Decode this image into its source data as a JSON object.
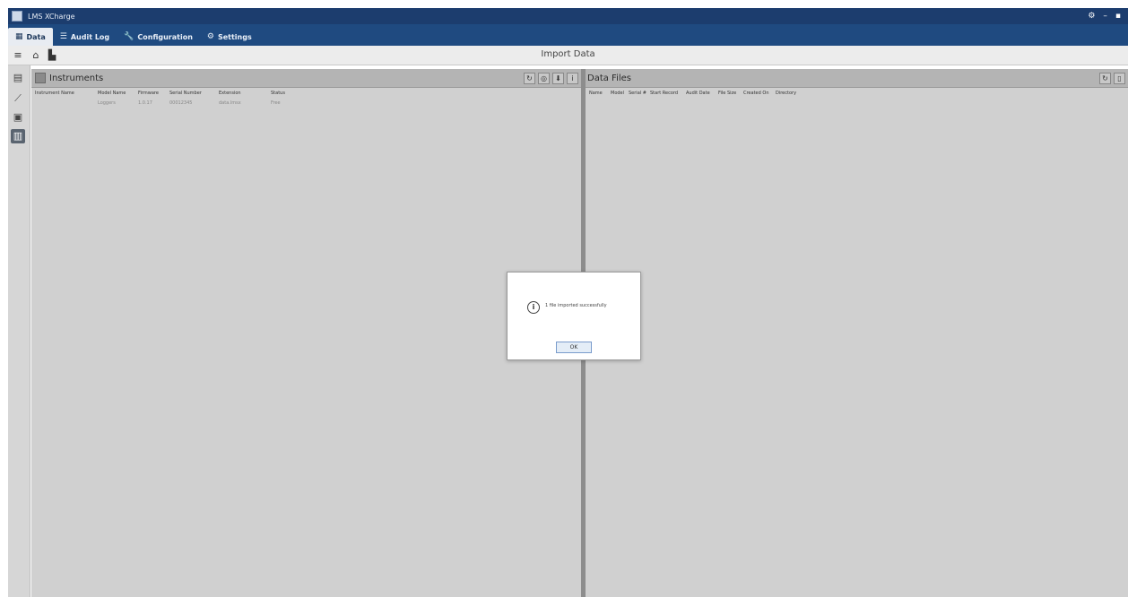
{
  "window": {
    "title": "LMS XCharge",
    "controls": [
      "⚙",
      "–",
      "▪"
    ]
  },
  "menu": [
    {
      "label": "Data",
      "icon": "▦",
      "active": true
    },
    {
      "label": "Audit Log",
      "icon": "☰",
      "active": false
    },
    {
      "label": "Configuration",
      "icon": "🔧",
      "active": false
    },
    {
      "label": "Settings",
      "icon": "⚙",
      "active": false
    }
  ],
  "toolbar": {
    "page_title": "Import Data"
  },
  "instruments": {
    "title": "Instruments",
    "columns": [
      "Instrument Name",
      "Model Name",
      "Firmware",
      "Serial Number",
      "Extension",
      "Status"
    ],
    "rows": [
      [
        "",
        "Loggers",
        "1.0.17",
        "00012345",
        "data.lmsx",
        "Free"
      ]
    ]
  },
  "datafiles": {
    "title": "Data Files",
    "columns": [
      "Name",
      "Model",
      "Serial #",
      "Start Record",
      "Audit Date",
      "File Size",
      "Created On",
      "Directory"
    ]
  },
  "dialog": {
    "message": "1 file imported successfully",
    "ok_label": "OK"
  }
}
